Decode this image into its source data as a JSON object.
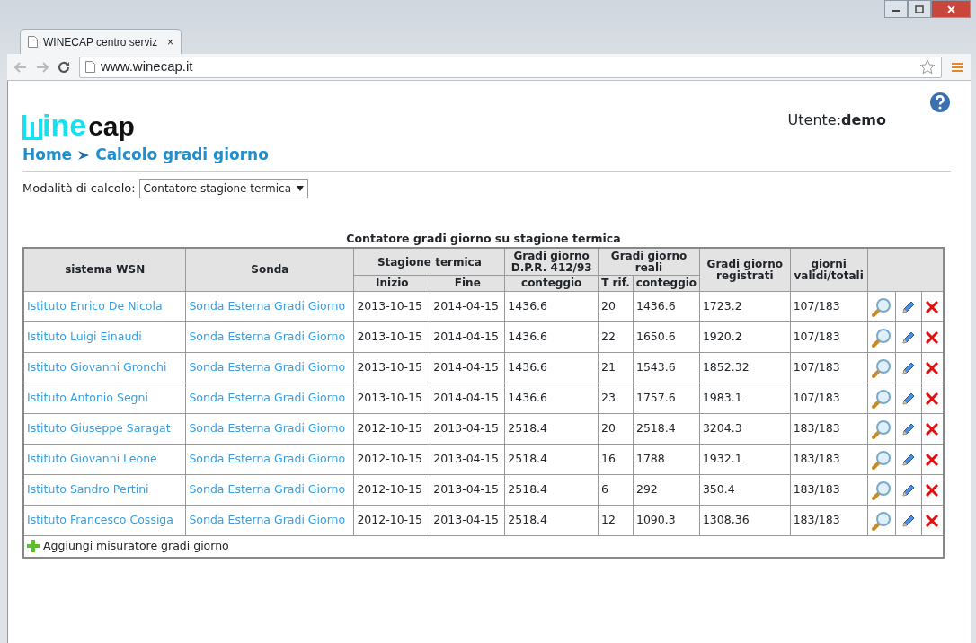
{
  "browser": {
    "tab_title": "WINECAP centro serviz",
    "tab_close": "×",
    "url": "www.winecap.it"
  },
  "header": {
    "logo_top": "ine",
    "logo_bottom": "cap",
    "user_label": "Utente:",
    "user_name": "demo"
  },
  "breadcrumb": [
    {
      "label": "Home"
    },
    {
      "label": "Calcolo gradi giorno"
    }
  ],
  "mode": {
    "label": "Modalità di calcolo:",
    "value": "Contatore stagione termica"
  },
  "table": {
    "caption": "Contatore gradi giorno su stagione termica",
    "header_top": [
      "sistema WSN",
      "Sonda",
      "Stagione termica",
      "Gradi giorno D.P.R. 412/93",
      "Gradi giorno reali",
      "Gradi giorno registrati",
      "giorni validi/totali"
    ],
    "header_sub": [
      "Inizio",
      "Fine",
      "conteggio",
      "T rif.",
      "conteggio"
    ],
    "rows": [
      {
        "sistema": "Istituto Enrico De Nicola",
        "sonda": "Sonda Esterna Gradi Giorno",
        "inizio": "2013-10-15",
        "fine": "2014-04-15",
        "dpr": "1436.6",
        "trif": "20",
        "reali": "1436.6",
        "registrati": "1723.2",
        "giorni": "107/183"
      },
      {
        "sistema": "Istituto Luigi Einaudi",
        "sonda": "Sonda Esterna Gradi Giorno",
        "inizio": "2013-10-15",
        "fine": "2014-04-15",
        "dpr": "1436.6",
        "trif": "22",
        "reali": "1650.6",
        "registrati": "1920.2",
        "giorni": "107/183"
      },
      {
        "sistema": "Istituto Giovanni Gronchi",
        "sonda": "Sonda Esterna Gradi Giorno",
        "inizio": "2013-10-15",
        "fine": "2014-04-15",
        "dpr": "1436.6",
        "trif": "21",
        "reali": "1543.6",
        "registrati": "1852.32",
        "giorni": "107/183"
      },
      {
        "sistema": "Istituto Antonio Segni",
        "sonda": "Sonda Esterna Gradi Giorno",
        "inizio": "2013-10-15",
        "fine": "2014-04-15",
        "dpr": "1436.6",
        "trif": "23",
        "reali": "1757.6",
        "registrati": "1983.1",
        "giorni": "107/183"
      },
      {
        "sistema": "Istituto Giuseppe Saragat",
        "sonda": "Sonda Esterna Gradi Giorno",
        "inizio": "2012-10-15",
        "fine": "2013-04-15",
        "dpr": "2518.4",
        "trif": "20",
        "reali": "2518.4",
        "registrati": "3204.3",
        "giorni": "183/183"
      },
      {
        "sistema": "Istituto Giovanni Leone",
        "sonda": "Sonda Esterna Gradi Giorno",
        "inizio": "2012-10-15",
        "fine": "2013-04-15",
        "dpr": "2518.4",
        "trif": "16",
        "reali": "1788",
        "registrati": "1932.1",
        "giorni": "183/183"
      },
      {
        "sistema": "Istituto Sandro Pertini",
        "sonda": "Sonda Esterna Gradi Giorno",
        "inizio": "2012-10-15",
        "fine": "2013-04-15",
        "dpr": "2518.4",
        "trif": "6",
        "reali": "292",
        "registrati": "350.4",
        "giorni": "183/183"
      },
      {
        "sistema": "Istituto Francesco Cossiga",
        "sonda": "Sonda Esterna Gradi Giorno",
        "inizio": "2012-10-15",
        "fine": "2013-04-15",
        "dpr": "2518.4",
        "trif": "12",
        "reali": "1090.3",
        "registrati": "1308,36",
        "giorni": "183/183"
      }
    ],
    "add_label": "Aggiungi misuratore gradi giorno"
  }
}
